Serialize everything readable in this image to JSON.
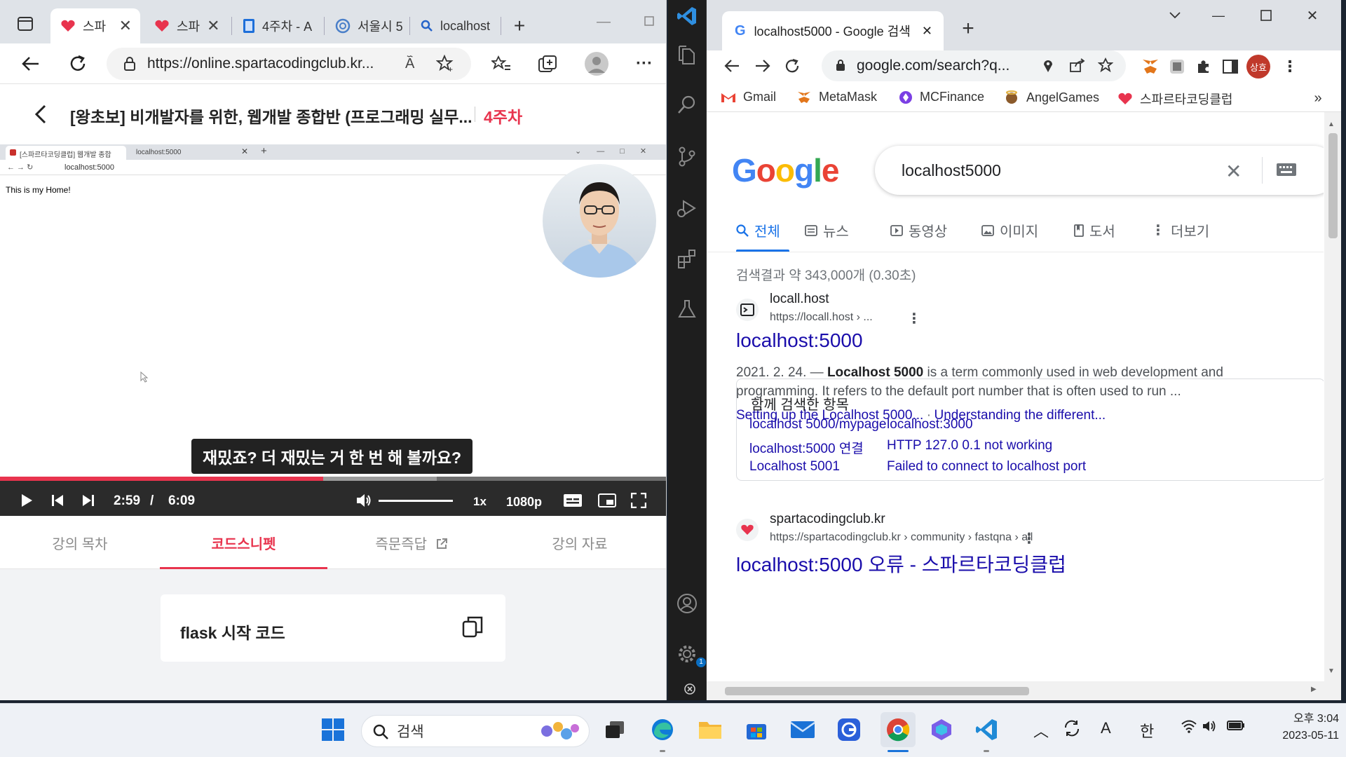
{
  "edge": {
    "tabs": [
      {
        "label": "스파",
        "active": true
      },
      {
        "label": "스파",
        "active": false
      },
      {
        "label": "4주차 - A",
        "active": false
      },
      {
        "label": "서울시 5",
        "active": false
      },
      {
        "label": "localhost",
        "active": false
      }
    ],
    "url": "https://online.spartacodingclub.kr...",
    "course": {
      "title": "[왕초보] 비개발자를 위한, 웹개발 종합반 (프로그래밍 실무...",
      "week": "4주차"
    },
    "video": {
      "mini_tab1": "[스파르타코딩클럽] 웹개발 종합",
      "mini_tab2": "localhost:5000",
      "mini_url": "localhost:5000",
      "page_text": "This is my Home!",
      "subtitle": "재밌죠? 더 재밌는 거 한 번 해 볼까요?",
      "current_time": "2:59",
      "time_sep": "/",
      "duration": "6:09",
      "speed": "1x",
      "quality": "1080p",
      "progress_fraction": 0.485,
      "buffered_fraction": 0.655
    },
    "lecture_tabs": [
      {
        "label": "강의 목차",
        "active": false
      },
      {
        "label": "코드스니펫",
        "active": true
      },
      {
        "label": "즉문즉답",
        "active": false
      },
      {
        "label": "강의 자료",
        "active": false
      }
    ],
    "snippet": {
      "title": "flask 시작 코드"
    }
  },
  "chrome": {
    "tab_title": "localhost5000 - Google 검색",
    "url": "google.com/search?q...",
    "profile_initials": "상효",
    "bookmarks": [
      "Gmail",
      "MetaMask",
      "MCFinance",
      "AngelGames",
      "스파르타코딩클럽"
    ],
    "search_query": "localhost5000",
    "tabs": [
      "전체",
      "뉴스",
      "동영상",
      "이미지",
      "도서",
      "더보기"
    ],
    "result_count": "검색결과 약 343,000개 (0.30초)",
    "results": [
      {
        "site": "locall.host",
        "url": "https://locall.host › ...",
        "title": "localhost:5000",
        "date": "2021. 2. 24. —",
        "snippet_bold": "Localhost 5000",
        "snippet_rest": " is a term commonly used in web development and programming. It refers to the default port number that is often used to run ...",
        "sublink1": "Setting up the Localhost 5000...",
        "sublink_sep": "·",
        "sublink2": "Understanding the different..."
      },
      {
        "site": "spartacodingclub.kr",
        "url": "https://spartacodingclub.kr › community › fastqna › all",
        "title": "localhost:5000 오류 - 스파르타코딩클럽"
      }
    ],
    "related": {
      "heading": "함께 검색한 항목",
      "items": [
        "localhost 5000/mypage",
        "localhost:5000 연결",
        "Localhost 5001",
        "localhost:3000",
        "HTTP 127.0 0.1 not working",
        "Failed to connect to localhost port"
      ]
    }
  },
  "taskbar": {
    "search_placeholder": "검색",
    "ime_lang": "한",
    "ime_mode": "A",
    "time": "오후 3:04",
    "date": "2023-05-11"
  },
  "colors": {
    "brand_red": "#e8344e",
    "google_link": "#1a0dab",
    "google_blue": "#1a73e8"
  }
}
